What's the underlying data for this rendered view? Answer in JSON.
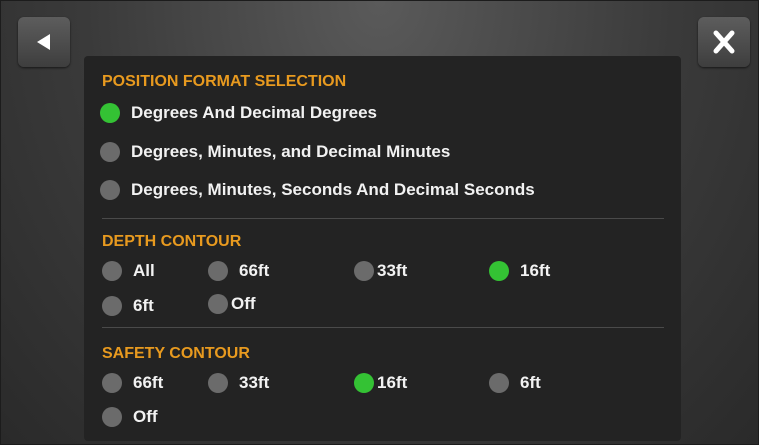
{
  "nav": {
    "back_icon": "back-arrow-icon",
    "close_icon": "close-x-icon"
  },
  "colors": {
    "accent": "#e89a1f",
    "selected": "#34c234",
    "unselected": "#6b6b6b"
  },
  "position_format": {
    "title": "POSITION FORMAT SELECTION",
    "options": [
      {
        "label": "Degrees  And Decimal Degrees",
        "selected": true
      },
      {
        "label": "Degrees, Minutes, and Decimal Minutes",
        "selected": false
      },
      {
        "label": "Degrees, Minutes, Seconds And Decimal Seconds",
        "selected": false
      }
    ]
  },
  "depth_contour": {
    "title": "DEPTH CONTOUR",
    "options": [
      {
        "label": "All",
        "selected": false
      },
      {
        "label": "66ft",
        "selected": false
      },
      {
        "label": "33ft",
        "selected": false
      },
      {
        "label": "16ft",
        "selected": true
      },
      {
        "label": "6ft",
        "selected": false
      },
      {
        "label": "Off",
        "selected": false
      }
    ]
  },
  "safety_contour": {
    "title": "SAFETY CONTOUR",
    "options": [
      {
        "label": "66ft",
        "selected": false
      },
      {
        "label": "33ft",
        "selected": false
      },
      {
        "label": "16ft",
        "selected": true
      },
      {
        "label": "6ft",
        "selected": false
      },
      {
        "label": "Off",
        "selected": false
      }
    ]
  }
}
